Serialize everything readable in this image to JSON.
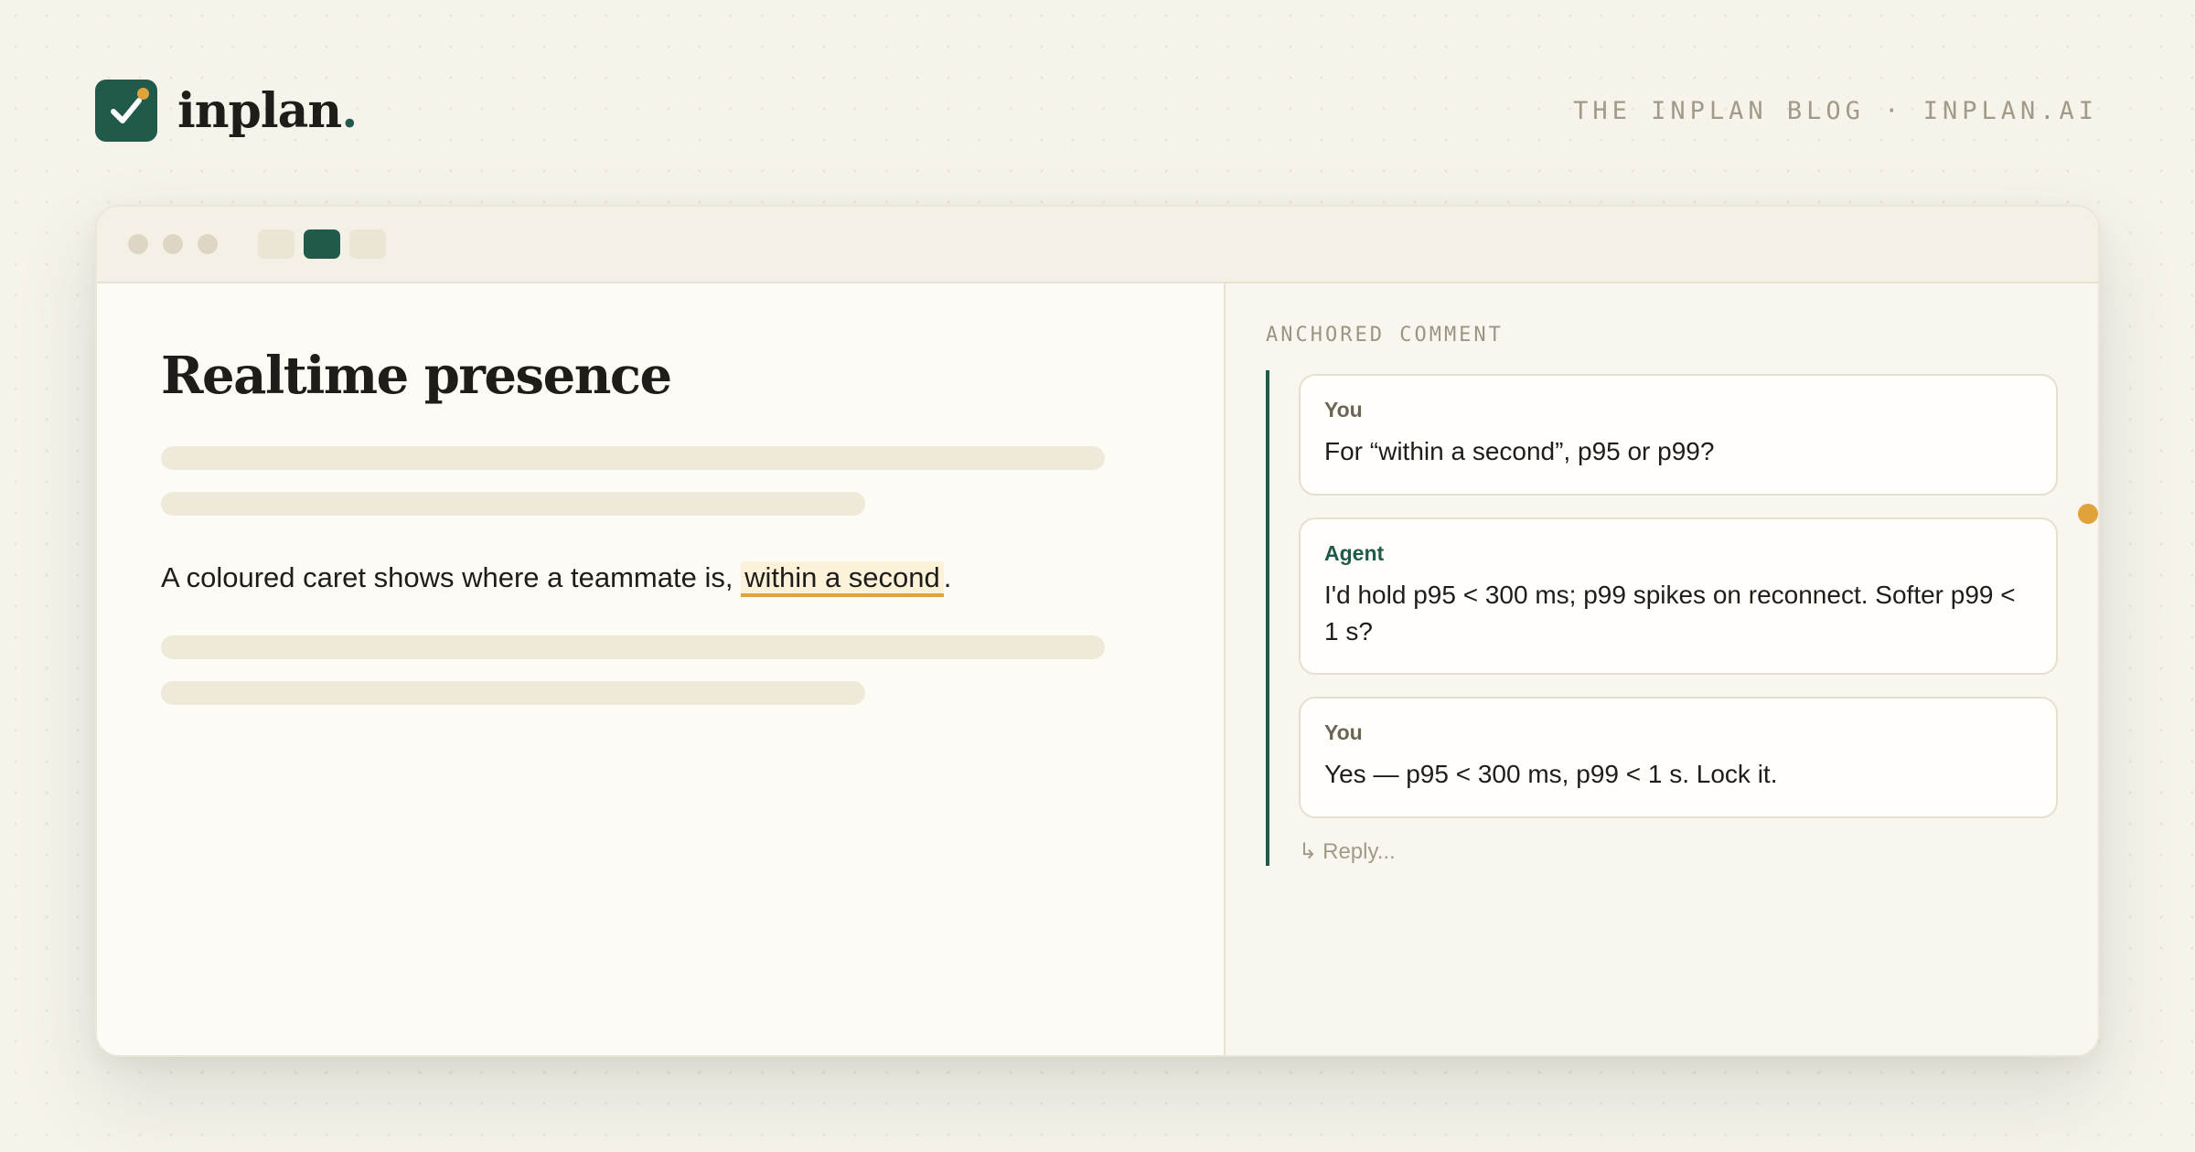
{
  "header": {
    "brand_name": "inplan",
    "brand_period": ".",
    "blog_tag": "THE INPLAN BLOG · INPLAN.AI"
  },
  "document": {
    "title": "Realtime presence",
    "paragraph_before": "A coloured caret shows where a teammate is, ",
    "anchored_text": "within a second",
    "paragraph_after": "."
  },
  "comments_panel": {
    "label": "ANCHORED COMMENT",
    "comments": [
      {
        "author": "You",
        "text": "For “within a second”, p95 or p99?"
      },
      {
        "author": "Agent",
        "text": "I'd hold p95 < 300 ms; p99 spikes on reconnect. Softer p99 < 1 s?"
      },
      {
        "author": "You",
        "text": "Yes — p95 < 300 ms, p99 < 1 s. Lock it."
      }
    ],
    "reply_arrow": "↳",
    "reply_placeholder": "Reply..."
  },
  "colors": {
    "brand_green": "#1f5a4b",
    "accent_amber": "#e0a33c",
    "background": "#f6f3ea"
  },
  "icons": {
    "logo": "check-icon"
  }
}
